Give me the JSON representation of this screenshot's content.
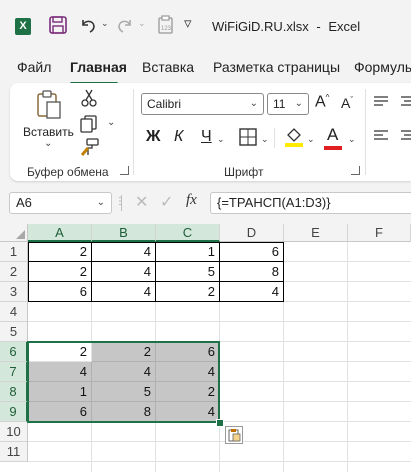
{
  "titlebar": {
    "app_icon": "X",
    "filename": "WiFiGiD.RU.xlsx",
    "separator": "-",
    "app_name": "Excel"
  },
  "tabs": [
    "Файл",
    "Главная",
    "Вставка",
    "Разметка страницы",
    "Формулы"
  ],
  "ribbon": {
    "clipboard": {
      "paste_label": "Вставить",
      "group_label": "Буфер обмена"
    },
    "font": {
      "font_name": "Calibri",
      "font_size": "11",
      "group_label": "Шрифт",
      "bold": "Ж",
      "italic": "К",
      "underline": "Ч",
      "font_color_letter": "A",
      "grow_font": "A",
      "shrink_font": "A"
    }
  },
  "formula_bar": {
    "name_box": "A6",
    "fx": "fx",
    "formula": "{=ТРАНСП(A1:D3)}"
  },
  "columns": [
    "A",
    "B",
    "C",
    "D",
    "E",
    "F"
  ],
  "rows": [
    "1",
    "2",
    "3",
    "4",
    "5",
    "6",
    "7",
    "8",
    "9",
    "10",
    "11"
  ],
  "cells": {
    "r1": [
      "2",
      "4",
      "1",
      "6"
    ],
    "r2": [
      "2",
      "4",
      "5",
      "8"
    ],
    "r3": [
      "6",
      "4",
      "2",
      "4"
    ],
    "r6": [
      "2",
      "2",
      "6"
    ],
    "r7": [
      "4",
      "4",
      "4"
    ],
    "r8": [
      "1",
      "5",
      "2"
    ],
    "r9": [
      "6",
      "8",
      "4"
    ]
  },
  "colors": {
    "accent": "#1e7145",
    "selection": "#c6c6c6"
  }
}
